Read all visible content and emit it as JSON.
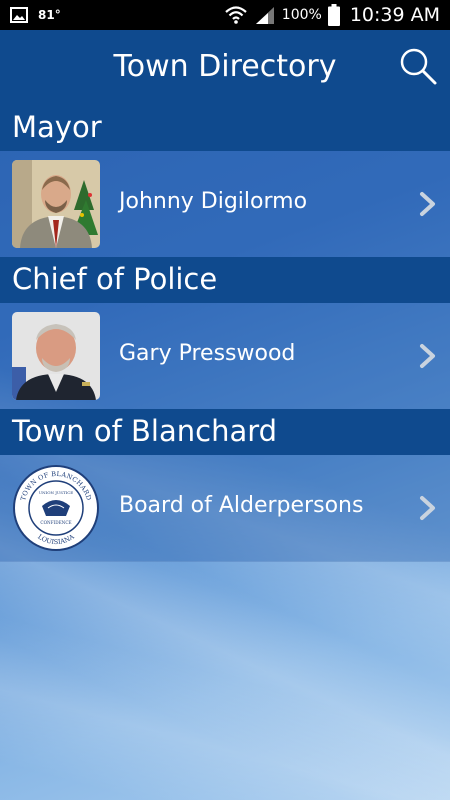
{
  "status_bar": {
    "temperature": "81°",
    "battery": "100%",
    "time": "10:39 AM"
  },
  "header": {
    "title": "Town Directory",
    "search_icon": "search-icon"
  },
  "sections": [
    {
      "title": "Mayor",
      "items": [
        {
          "label": "Johnny Digilormo",
          "avatar": "person-photo"
        }
      ]
    },
    {
      "title": "Chief of Police",
      "items": [
        {
          "label": "Gary Presswood",
          "avatar": "person-photo"
        }
      ]
    },
    {
      "title": "Town of Blanchard",
      "items": [
        {
          "label": "Board of Alderpersons",
          "avatar": "town-seal"
        }
      ]
    }
  ],
  "seal": {
    "top_text": "TOWN OF BLANCHARD",
    "bottom_text": "LOUISIANA",
    "inner_top": "UNION JUSTICE",
    "inner_bottom": "CONFIDENCE"
  },
  "colors": {
    "header_bar": "#0f4a8e",
    "background": "#3a74c4"
  }
}
